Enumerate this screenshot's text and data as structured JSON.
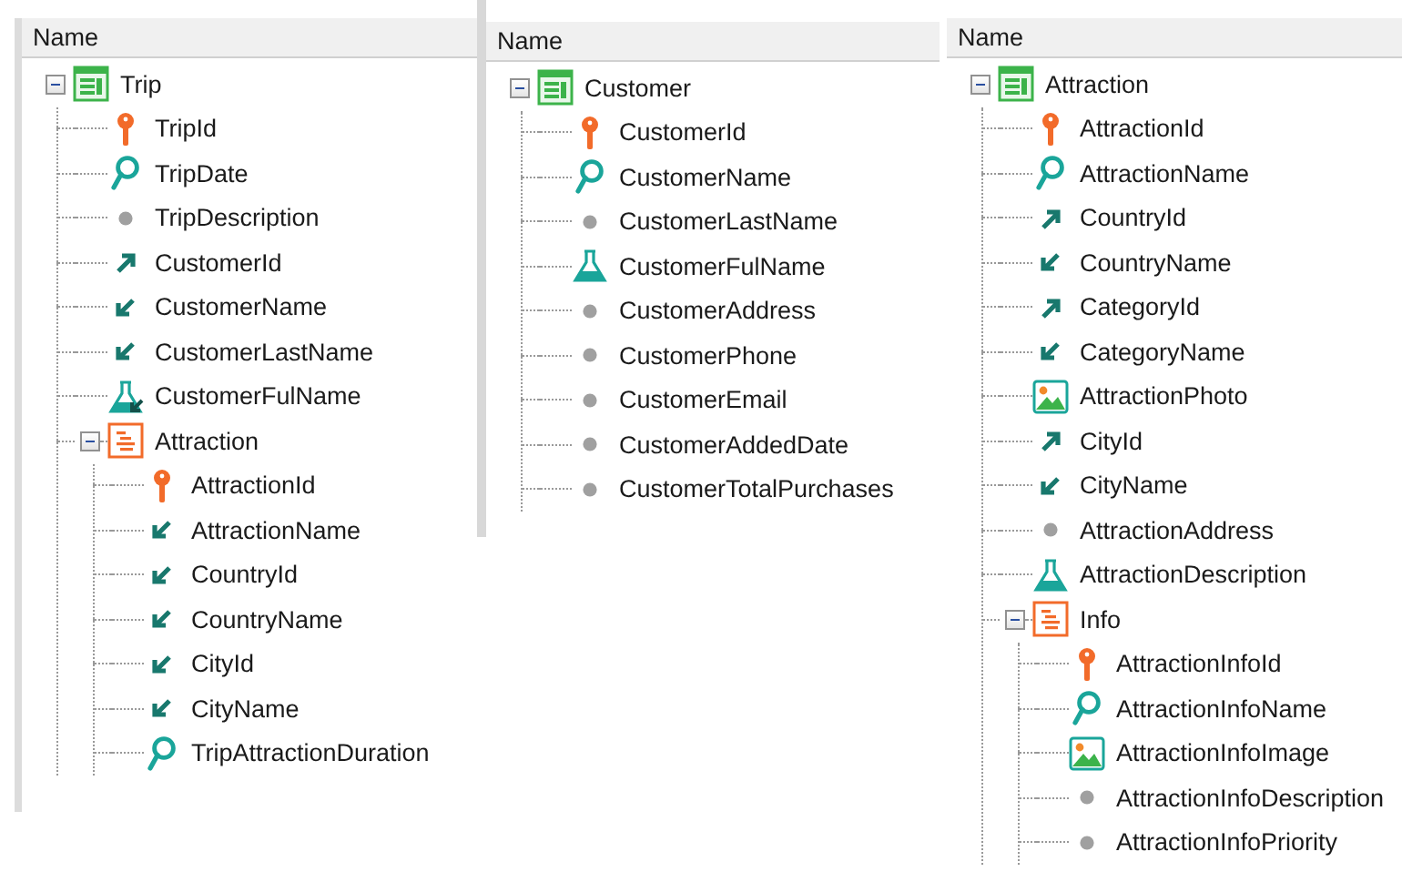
{
  "panels": [
    {
      "header": "Name",
      "root": {
        "label": "Trip",
        "kind": "table",
        "expanded": true,
        "children": [
          {
            "label": "TripId",
            "kind": "key"
          },
          {
            "label": "TripDate",
            "kind": "search"
          },
          {
            "label": "TripDescription",
            "kind": "attribute"
          },
          {
            "label": "CustomerId",
            "kind": "fk_out"
          },
          {
            "label": "CustomerName",
            "kind": "fk_in"
          },
          {
            "label": "CustomerLastName",
            "kind": "fk_in"
          },
          {
            "label": "CustomerFulName",
            "kind": "formula_in"
          },
          {
            "label": "Attraction",
            "kind": "level",
            "expanded": true,
            "children": [
              {
                "label": "AttractionId",
                "kind": "key"
              },
              {
                "label": "AttractionName",
                "kind": "fk_in"
              },
              {
                "label": "CountryId",
                "kind": "fk_in"
              },
              {
                "label": "CountryName",
                "kind": "fk_in"
              },
              {
                "label": "CityId",
                "kind": "fk_in"
              },
              {
                "label": "CityName",
                "kind": "fk_in"
              },
              {
                "label": "TripAttractionDuration",
                "kind": "search"
              }
            ]
          }
        ]
      }
    },
    {
      "header": "Name",
      "root": {
        "label": "Customer",
        "kind": "table",
        "expanded": true,
        "children": [
          {
            "label": "CustomerId",
            "kind": "key"
          },
          {
            "label": "CustomerName",
            "kind": "search"
          },
          {
            "label": "CustomerLastName",
            "kind": "attribute"
          },
          {
            "label": "CustomerFulName",
            "kind": "formula"
          },
          {
            "label": "CustomerAddress",
            "kind": "attribute"
          },
          {
            "label": "CustomerPhone",
            "kind": "attribute"
          },
          {
            "label": "CustomerEmail",
            "kind": "attribute"
          },
          {
            "label": "CustomerAddedDate",
            "kind": "attribute"
          },
          {
            "label": "CustomerTotalPurchases",
            "kind": "attribute"
          }
        ]
      }
    },
    {
      "header": "Name",
      "root": {
        "label": "Attraction",
        "kind": "table",
        "expanded": true,
        "children": [
          {
            "label": "AttractionId",
            "kind": "key"
          },
          {
            "label": "AttractionName",
            "kind": "search"
          },
          {
            "label": "CountryId",
            "kind": "fk_out"
          },
          {
            "label": "CountryName",
            "kind": "fk_in"
          },
          {
            "label": "CategoryId",
            "kind": "fk_out"
          },
          {
            "label": "CategoryName",
            "kind": "fk_in"
          },
          {
            "label": "AttractionPhoto",
            "kind": "image"
          },
          {
            "label": "CityId",
            "kind": "fk_out"
          },
          {
            "label": "CityName",
            "kind": "fk_in"
          },
          {
            "label": "AttractionAddress",
            "kind": "attribute"
          },
          {
            "label": "AttractionDescription",
            "kind": "formula"
          },
          {
            "label": "Info",
            "kind": "level",
            "expanded": true,
            "children": [
              {
                "label": "AttractionInfoId",
                "kind": "key"
              },
              {
                "label": "AttractionInfoName",
                "kind": "search"
              },
              {
                "label": "AttractionInfoImage",
                "kind": "image"
              },
              {
                "label": "AttractionInfoDescription",
                "kind": "attribute"
              },
              {
                "label": "AttractionInfoPriority",
                "kind": "attribute"
              }
            ]
          }
        ]
      }
    }
  ]
}
